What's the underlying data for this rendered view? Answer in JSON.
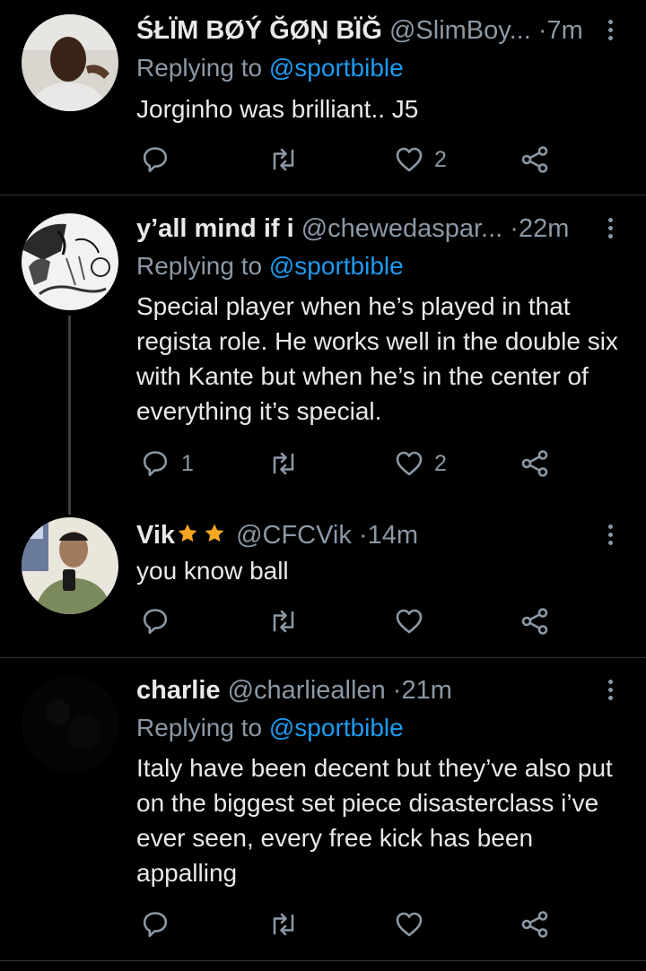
{
  "colors": {
    "background": "#000000",
    "text": "#e7e9ea",
    "muted": "#8b98a5",
    "accent": "#1d9bf0",
    "star": "#f5a623"
  },
  "tweets": [
    {
      "name": "ŚŁÏM BØÝ ĞØŅ BÏĞ",
      "handle": "@SlimBoy...",
      "time": "7m",
      "replying_prefix": "Replying to",
      "replying_to": "@sportbible",
      "text": "Jorginho was brilliant.. J5",
      "reply_count": "",
      "retweet_count": "",
      "like_count": "2",
      "icons": [
        "reply-icon",
        "retweet-icon",
        "like-icon",
        "share-icon",
        "more-icon"
      ]
    },
    {
      "name": "y’all mind if i",
      "handle": "@chewedaspar...",
      "time": "22m",
      "replying_prefix": "Replying to",
      "replying_to": "@sportbible",
      "text": "Special player when he’s played in that regista role. He works well in the double six with Kante but when he’s in  the center of everything it’s special.",
      "reply_count": "1",
      "retweet_count": "",
      "like_count": "2",
      "icons": [
        "reply-icon",
        "retweet-icon",
        "like-icon",
        "share-icon",
        "more-icon"
      ]
    },
    {
      "name": "Vik",
      "name_decoration": "two-star-emoji",
      "handle": "@CFCVik",
      "time": "14m",
      "text": "you know ball",
      "reply_count": "",
      "retweet_count": "",
      "like_count": "",
      "icons": [
        "reply-icon",
        "retweet-icon",
        "like-icon",
        "share-icon",
        "more-icon"
      ]
    },
    {
      "name": "charlie",
      "handle": "@charlieallen",
      "time": "21m",
      "replying_prefix": "Replying to",
      "replying_to": "@sportbible",
      "text": "Italy have been decent but they’ve also put on the biggest set piece disasterclass i’ve ever seen, every free kick has been appalling",
      "reply_count": "",
      "retweet_count": "",
      "like_count": "",
      "icons": [
        "reply-icon",
        "retweet-icon",
        "like-icon",
        "share-icon",
        "more-icon"
      ]
    }
  ]
}
